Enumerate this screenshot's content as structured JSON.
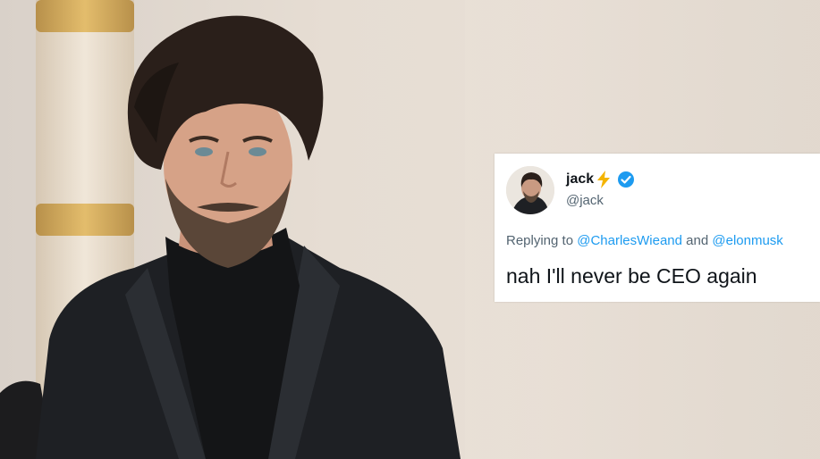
{
  "tweet": {
    "display_name": "jack",
    "name_emoji_icon": "lightning-bolt-icon",
    "verified_icon": "verified-badge-icon",
    "handle": "@jack",
    "reply_prefix": "Replying to",
    "reply_mention_1": "@CharlesWieand",
    "reply_joiner": "and",
    "reply_mention_2": "@elonmusk",
    "text": "nah I'll never be CEO again"
  },
  "colors": {
    "accent_blue": "#1d9bf0",
    "text_dark": "#0f1419",
    "text_muted": "#536471",
    "bolt_yellow": "#f4b400"
  }
}
